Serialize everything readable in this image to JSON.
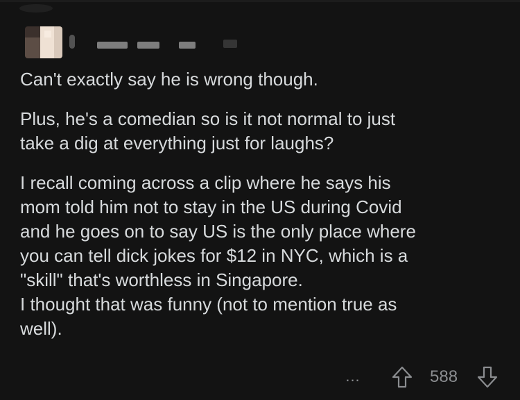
{
  "comment": {
    "paragraphs": [
      {
        "lines": [
          "Can't exactly say he is wrong though."
        ]
      },
      {
        "lines": [
          "Plus, he's a comedian so is it not normal to just",
          "take a dig at everything just for laughs?"
        ]
      },
      {
        "lines": [
          "I recall coming across a clip where he says his",
          "mom told him not to stay in the US during Covid",
          "and he goes on to say US is the only place where",
          "you can tell dick jokes for $12 in NYC, which is a",
          "\"skill\" that's worthless in Singapore.",
          "I thought that was funny (not to mention true as",
          "well)."
        ]
      }
    ]
  },
  "actions": {
    "more_label": "...",
    "score": "588",
    "upvote_icon": "arrow-up-outline-icon",
    "downvote_icon": "arrow-down-outline-icon",
    "icon_color": "#8b8d90"
  },
  "colors": {
    "background": "#131313",
    "text": "#d7dadc",
    "muted": "#8b8d90"
  }
}
